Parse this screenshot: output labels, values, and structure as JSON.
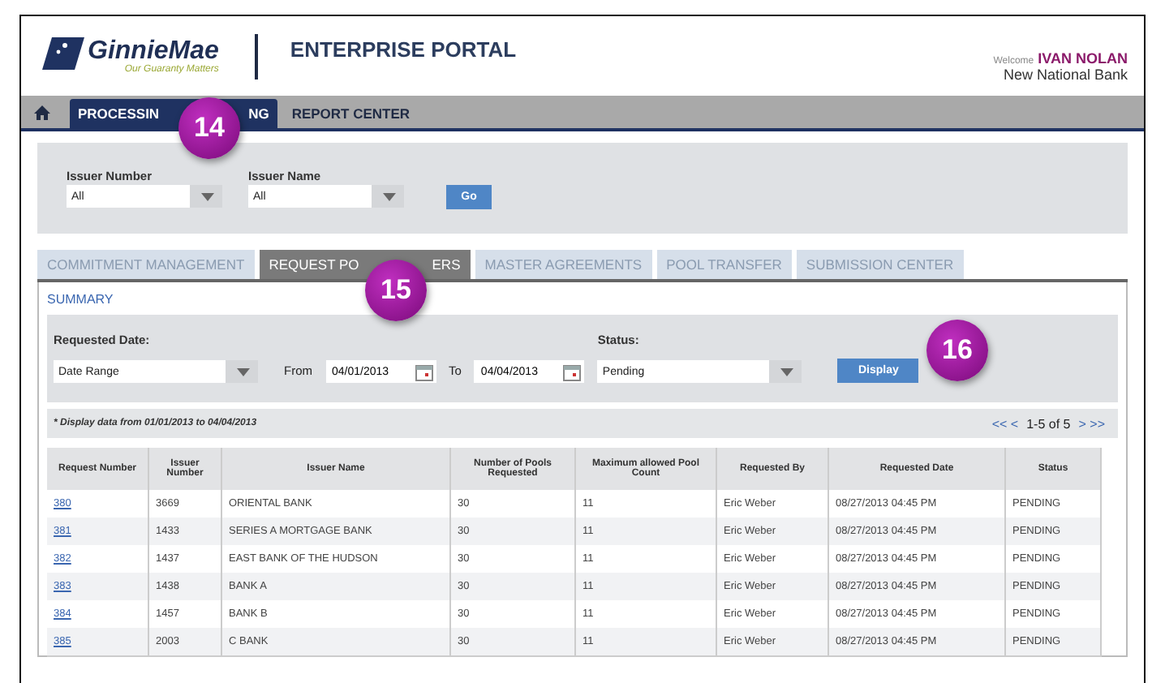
{
  "header": {
    "logo_text": "GinnieMae",
    "tagline": "Our Guaranty Matters",
    "title": "ENTERPRISE PORTAL",
    "welcome": "Welcome",
    "user": "IVAN NOLAN",
    "organization": "New National Bank"
  },
  "nav": [
    {
      "parts": [
        "PROCESSIN",
        "NG"
      ],
      "selected": true
    },
    {
      "parts": [
        "REPORT CENTER"
      ],
      "selected": false
    }
  ],
  "issuer_filter": {
    "fields": [
      {
        "label": "Issuer Number",
        "value": "All"
      },
      {
        "label": "Issuer Name",
        "value": "All"
      }
    ],
    "button": "Go"
  },
  "tabs": [
    {
      "parts": [
        "COMMITMENT MANAGEMENT"
      ],
      "selected": false
    },
    {
      "parts": [
        "REQUEST PO",
        "ERS"
      ],
      "selected": true
    },
    {
      "parts": [
        "MASTER AGREEMENTS"
      ],
      "selected": false
    },
    {
      "parts": [
        "POOL TRANSFER"
      ],
      "selected": false
    },
    {
      "parts": [
        "SUBMISSION CENTER"
      ],
      "selected": false
    }
  ],
  "summary_link": "SUMMARY",
  "search": {
    "date_label": "Requested Date:",
    "date_mode": "Date Range",
    "from_label": "From",
    "from": "04/01/2013",
    "to_label": "To",
    "to": "04/04/2013",
    "status_label": "Status:",
    "status": "Pending",
    "button": "Display"
  },
  "note": "* Display data from 01/01/2013 to 04/04/2013",
  "pager": {
    "first_prev": "<< <",
    "range": "1-5 of 5",
    "next_last": "> >>"
  },
  "table": {
    "columns": [
      "Request Number",
      "Issuer Number",
      "Issuer Name",
      "Number of Pools Requested",
      "Maximum allowed Pool Count",
      "Requested By",
      "Requested Date",
      "Status"
    ],
    "rows": [
      [
        "380",
        "3669",
        "ORIENTAL BANK",
        "30",
        "11",
        "Eric Weber",
        "08/27/2013  04:45 PM",
        "PENDING"
      ],
      [
        "381",
        "1433",
        "SERIES A MORTGAGE BANK",
        "30",
        "11",
        "Eric Weber",
        "08/27/2013  04:45 PM",
        "PENDING"
      ],
      [
        "382",
        "1437",
        "EAST BANK OF THE HUDSON",
        "30",
        "11",
        "Eric Weber",
        "08/27/2013  04:45 PM",
        "PENDING"
      ],
      [
        "383",
        "1438",
        "BANK A",
        "30",
        "11",
        "Eric Weber",
        "08/27/2013  04:45 PM",
        "PENDING"
      ],
      [
        "384",
        "1457",
        "BANK B",
        "30",
        "11",
        "Eric Weber",
        "08/27/2013  04:45 PM",
        "PENDING"
      ],
      [
        "385",
        "2003",
        "C BANK",
        "30",
        "11",
        "Eric Weber",
        "08/27/2013  04:45 PM",
        "PENDING"
      ]
    ]
  },
  "callouts": [
    {
      "number": "14",
      "kind": "nav"
    },
    {
      "number": "15",
      "kind": "tabs"
    },
    {
      "number": "16",
      "kind": "search"
    }
  ]
}
